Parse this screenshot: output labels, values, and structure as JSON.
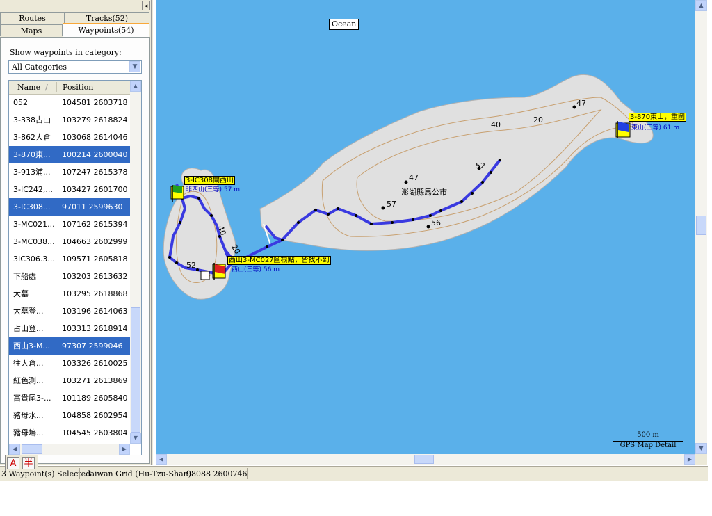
{
  "tabs": {
    "routes": "Routes",
    "tracks": "Tracks(52)",
    "maps": "Maps",
    "waypoints": "Waypoints(54)"
  },
  "collapse_icon": "◂",
  "category": {
    "label": "Show waypoints in category:",
    "selected": "All Categories"
  },
  "list": {
    "header": {
      "name": "Name",
      "sort_indicator": "/",
      "position": "Position"
    },
    "rows": [
      {
        "name": "052",
        "position": "104581 2603718",
        "selected": false
      },
      {
        "name": "3-338占山",
        "position": "103279 2618824",
        "selected": false
      },
      {
        "name": "3-862大倉",
        "position": "103068 2614046",
        "selected": false
      },
      {
        "name": "3-870東...",
        "position": "100214 2600040",
        "selected": true
      },
      {
        "name": "3-913浦...",
        "position": "107247 2615378",
        "selected": false
      },
      {
        "name": "3-IC242,...",
        "position": "103427 2601700",
        "selected": false
      },
      {
        "name": "3-IC308...",
        "position": "97011 2599630",
        "selected": true
      },
      {
        "name": "3-MC021...",
        "position": "107162 2615394",
        "selected": false
      },
      {
        "name": "3-MC038...",
        "position": "104663 2602999",
        "selected": false
      },
      {
        "name": "3IC306.3...",
        "position": "109571 2605818",
        "selected": false
      },
      {
        "name": "下船處",
        "position": "103203 2613632",
        "selected": false
      },
      {
        "name": "大墓",
        "position": "103295 2618868",
        "selected": false
      },
      {
        "name": "大墓登...",
        "position": "103196 2614063",
        "selected": false
      },
      {
        "name": "占山登...",
        "position": "103313 2618914",
        "selected": false
      },
      {
        "name": "西山3-M...",
        "position": "97307 2599046",
        "selected": true
      },
      {
        "name": "往大倉...",
        "position": "103326 2610025",
        "selected": false
      },
      {
        "name": "紅色測...",
        "position": "103271 2613869",
        "selected": false
      },
      {
        "name": "富貴尾3-...",
        "position": "101189 2605840",
        "selected": false
      },
      {
        "name": "豬母水...",
        "position": "104858 2602954",
        "selected": false
      },
      {
        "name": "豬母塢...",
        "position": "104545 2603804",
        "selected": false
      }
    ]
  },
  "ime": {
    "left": "A",
    "right": "半"
  },
  "map": {
    "ocean_label": "Ocean",
    "city": "澎湖縣馬公市",
    "spot_heights": [
      "47",
      "52",
      "47",
      "57",
      "56",
      "40",
      "20",
      "40",
      "52",
      "20"
    ],
    "waypoints": [
      {
        "label": "3-IC308閘西山",
        "elev": "非西山(三等) 57 m",
        "flag": "green"
      },
      {
        "label": "西山3-MC027圖根點，皆找不到",
        "elev": "西山(三等) 56 m",
        "flag": "red"
      },
      {
        "label": "3-870東山，重圖",
        "elev": "東山(三等) 61 m",
        "flag": "blue"
      }
    ],
    "scale_label": "500 m",
    "scale_caption": "GPS Map Detail",
    "colors": {
      "water": "#5ab0ea",
      "land": "#e0e0e0",
      "track": "#3a3ae0",
      "contour": "#c8a070"
    }
  },
  "status": {
    "selection": "3 Waypoint(s) Selected",
    "grid": "Taiwan Grid (Hu-Tzu-Shan)",
    "coords": "98088 2600746"
  }
}
